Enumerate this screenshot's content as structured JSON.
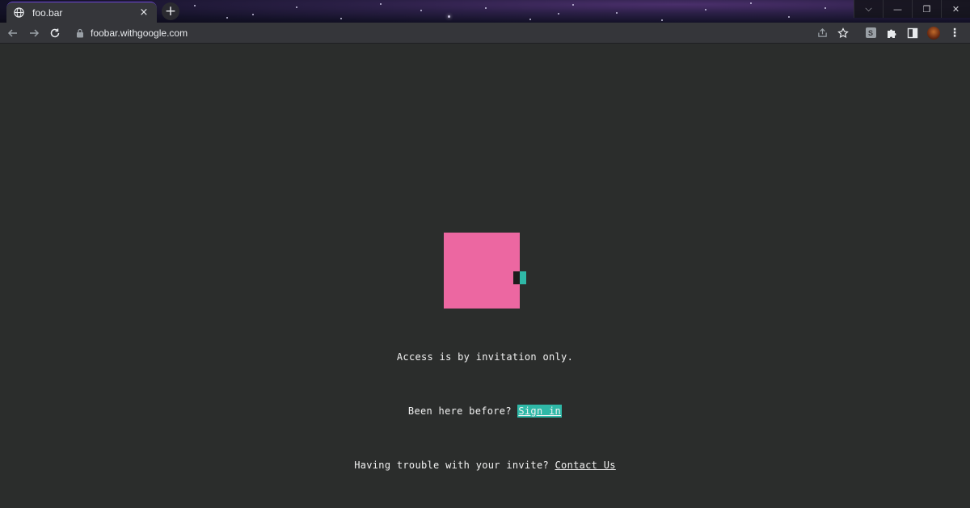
{
  "browser": {
    "tab": {
      "title": "foo.bar",
      "close_label": "×"
    },
    "new_tab_label": "+",
    "window_controls": {
      "dropdown": "⌵",
      "minimize": "—",
      "restore": "❐",
      "close": "✕"
    },
    "address": {
      "url": "foobar.withgoogle.com"
    },
    "extensions": {
      "s_label": "S"
    },
    "menu_label": "⋮"
  },
  "page": {
    "access_text": "Access is by invitation only.",
    "been_here_text": "Been here before?",
    "sign_in_label": "Sign in",
    "trouble_text": "Having trouble with your invite?",
    "contact_label": "Contact Us"
  },
  "colors": {
    "background": "#2b2d2c",
    "logo_pink": "#ec67a1",
    "accent_teal": "#2fb8a7"
  }
}
